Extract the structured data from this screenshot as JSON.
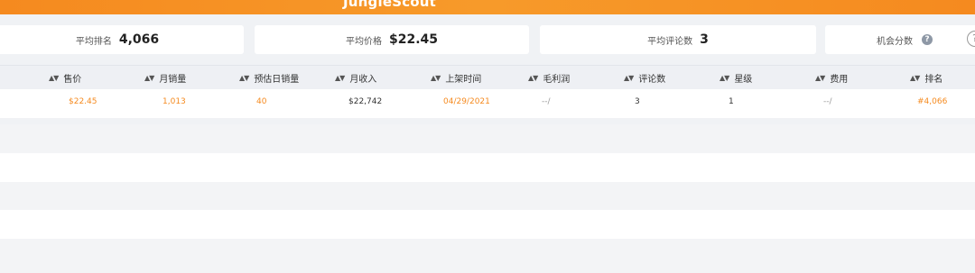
{
  "header": {
    "brand": "JungleScout",
    "accent": "#f58a1f"
  },
  "stats": [
    {
      "label": "平均排名",
      "value": "4,066"
    },
    {
      "label": "平均价格",
      "value": "$22.45"
    },
    {
      "label": "平均评论数",
      "value": "3"
    },
    {
      "label": "机会分数",
      "value": ""
    }
  ],
  "table": {
    "columns": [
      "售价",
      "月销量",
      "预估日销量",
      "月收入",
      "上架时间",
      "毛利润",
      "评论数",
      "星级",
      "费用",
      "排名"
    ],
    "rows": [
      [
        "$22.45",
        "1,013",
        "40",
        "$22,742",
        "04/29/2021",
        "--/",
        "3",
        "1",
        "--/",
        "#4,066"
      ]
    ]
  },
  "icons": {
    "help": "help-icon",
    "info_ring": "question-circle-icon",
    "sort": "sort-icon"
  }
}
